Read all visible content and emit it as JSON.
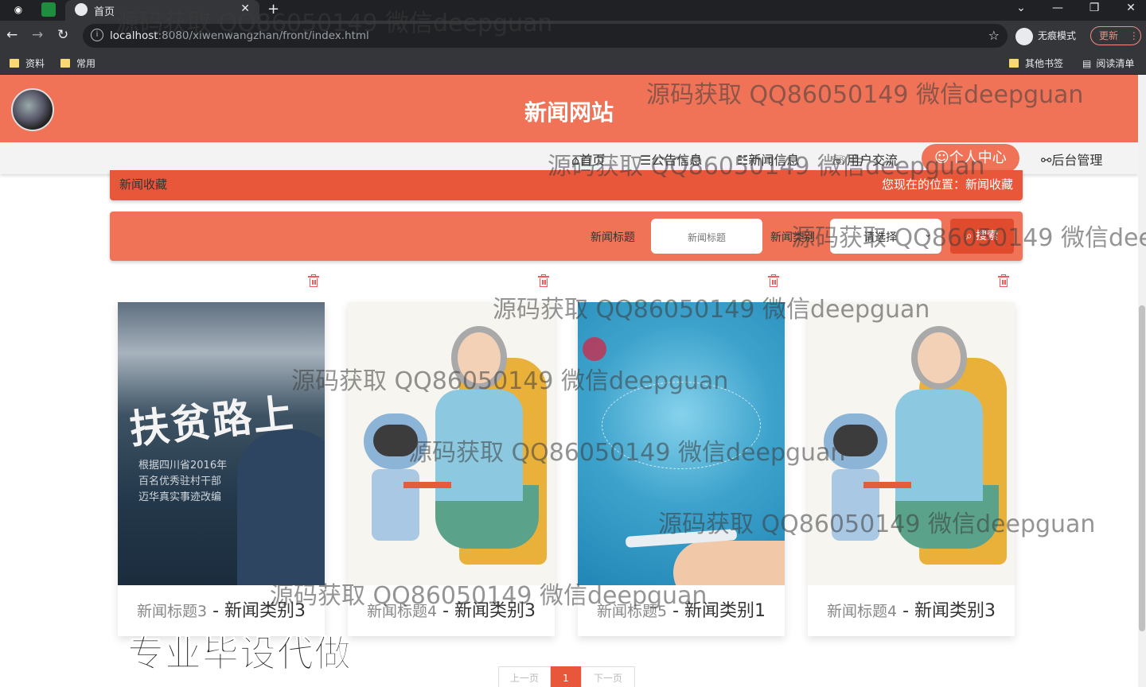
{
  "browser": {
    "tab_title": "首页",
    "url_host": "localhost",
    "url_rest": ":8080/xiwenwangzhan/front/index.html",
    "incognito_label": "无痕模式",
    "update_label": "更新",
    "bookmarks": [
      "资料",
      "常用"
    ],
    "bookmarks_right": [
      "其他书签",
      "阅读清单"
    ]
  },
  "site": {
    "title": "新闻网站",
    "nav": [
      "首页",
      "公告信息",
      "新闻信息",
      "用户交流",
      "个人中心",
      "后台管理"
    ],
    "active_nav": "个人中心"
  },
  "breadcrumb": {
    "section": "新闻收藏",
    "location": "您现在的位置：新闻收藏"
  },
  "search": {
    "title_label": "新闻标题",
    "title_placeholder": "新闻标题",
    "type_label": "新闻类别",
    "type_selected": "请选择",
    "button_label": "搜索"
  },
  "cards": [
    {
      "title": "新闻标题3",
      "category": "新闻类别3",
      "image": "poverty-alleviation-poster"
    },
    {
      "title": "新闻标题4",
      "category": "新闻类别3",
      "image": "grandma-robot-cartoon"
    },
    {
      "title": "新闻标题5",
      "category": "新闻类别1",
      "image": "tech-tablet-network"
    },
    {
      "title": "新闻标题4",
      "category": "新闻类别3",
      "image": "grandma-robot-cartoon"
    }
  ],
  "poster_text": {
    "headline": "扶贫路上",
    "lines": [
      "根据四川省2016年",
      "百名优秀驻村干部",
      "迈华真实事迹改编"
    ]
  },
  "pagination": {
    "prev": "上一页",
    "current": "1",
    "next": "下一页"
  },
  "overlay": {
    "watermark": "源码获取 QQ86050149 微信deepguan",
    "promo": "专业毕设代做"
  },
  "colors": {
    "accent": "#f07358",
    "accent_dark": "#e8573a",
    "delete": "#f15a5a"
  }
}
